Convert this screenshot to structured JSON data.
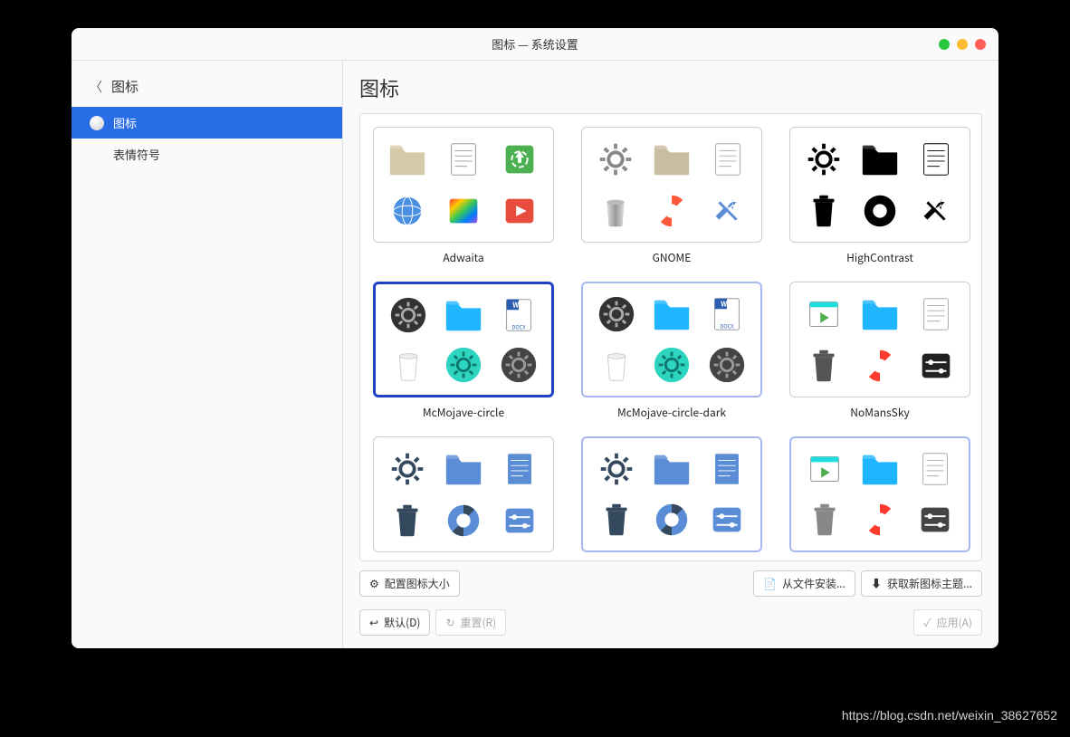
{
  "window": {
    "title": "图标 — 系统设置"
  },
  "sidebar": {
    "back_label": "图标",
    "items": [
      {
        "label": "图标",
        "active": true
      },
      {
        "label": "表情符号",
        "active": false
      }
    ]
  },
  "main": {
    "title": "图标",
    "themes": [
      {
        "label": "Adwaita",
        "state": "normal",
        "style": "adwaita"
      },
      {
        "label": "GNOME",
        "state": "normal",
        "style": "gnome"
      },
      {
        "label": "HighContrast",
        "state": "normal",
        "style": "highcontrast"
      },
      {
        "label": "McMojave-circle",
        "state": "selected",
        "style": "mcmojave"
      },
      {
        "label": "McMojave-circle-dark",
        "state": "hover",
        "style": "mcmojave"
      },
      {
        "label": "NoMansSky",
        "state": "normal",
        "style": "nomanssky"
      },
      {
        "label": "",
        "state": "normal",
        "style": "flatblue"
      },
      {
        "label": "",
        "state": "hover",
        "style": "flatblue"
      },
      {
        "label": "",
        "state": "hover",
        "style": "nomanssky-light"
      }
    ],
    "toolbar": {
      "configure_size": "配置图标大小",
      "install_from_file": "从文件安装...",
      "get_new_themes": "获取新图标主题..."
    },
    "footer": {
      "defaults": "默认(D)",
      "reset": "重置(R)",
      "apply": "应用(A)"
    }
  },
  "watermark": "https://blog.csdn.net/weixin_38627652"
}
